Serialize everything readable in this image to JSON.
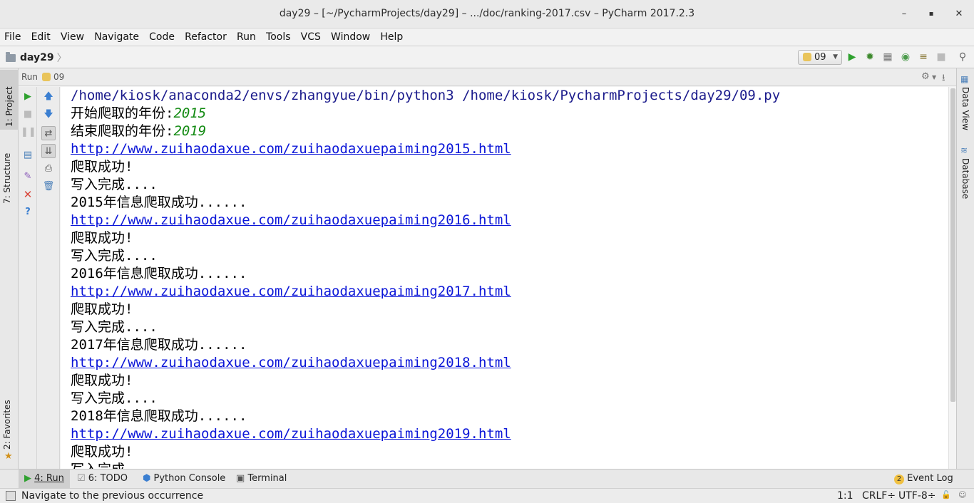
{
  "window": {
    "title": "day29 – [~/PycharmProjects/day29] – .../doc/ranking-2017.csv – PyCharm 2017.2.3",
    "minimize": "–",
    "maximize": "▪",
    "close": "✕"
  },
  "menu": [
    "File",
    "Edit",
    "View",
    "Navigate",
    "Code",
    "Refactor",
    "Run",
    "Tools",
    "VCS",
    "Window",
    "Help"
  ],
  "nav": {
    "breadcrumb": "day29",
    "run_config": "09"
  },
  "left_tabs": {
    "project": "1: Project",
    "structure": "7: Structure",
    "favorites": "2: Favorites"
  },
  "right_tabs": {
    "data_view": "Data View",
    "database": "Database"
  },
  "run_panel": {
    "label": "Run",
    "config": "09"
  },
  "console": {
    "command": "/home/kiosk/anaconda2/envs/zhangyue/bin/python3 /home/kiosk/PycharmProjects/day29/09.py",
    "prompt_start": "开始爬取的年份:",
    "input_start": "2015",
    "prompt_end": "结束爬取的年份:",
    "input_end": "2019",
    "blocks": [
      {
        "url": "http://www.zuihaodaxue.com/zuihaodaxuepaiming2015.html",
        "ok": "爬取成功!",
        "write": "写入完成....",
        "done": "2015年信息爬取成功......"
      },
      {
        "url": "http://www.zuihaodaxue.com/zuihaodaxuepaiming2016.html",
        "ok": "爬取成功!",
        "write": "写入完成....",
        "done": "2016年信息爬取成功......"
      },
      {
        "url": "http://www.zuihaodaxue.com/zuihaodaxuepaiming2017.html",
        "ok": "爬取成功!",
        "write": "写入完成....",
        "done": "2017年信息爬取成功......"
      },
      {
        "url": "http://www.zuihaodaxue.com/zuihaodaxuepaiming2018.html",
        "ok": "爬取成功!",
        "write": "写入完成....",
        "done": "2018年信息爬取成功......"
      },
      {
        "url": "http://www.zuihaodaxue.com/zuihaodaxuepaiming2019.html",
        "ok": "爬取成功!",
        "write": "写入完成....",
        "done": ""
      }
    ]
  },
  "bottom_tabs": {
    "run": "4: Run",
    "todo": "6: TODO",
    "python_console": "Python Console",
    "terminal": "Terminal",
    "event_log": "Event Log",
    "event_count": "2"
  },
  "status": {
    "message": "Navigate to the previous occurrence",
    "position": "1:1",
    "line_sep": "CRLF÷",
    "encoding": "UTF-8÷"
  },
  "colors": {
    "link": "#0b16d8",
    "command": "#1b1b8c",
    "user_input": "#128a12",
    "run_green": "#2fa12f"
  }
}
